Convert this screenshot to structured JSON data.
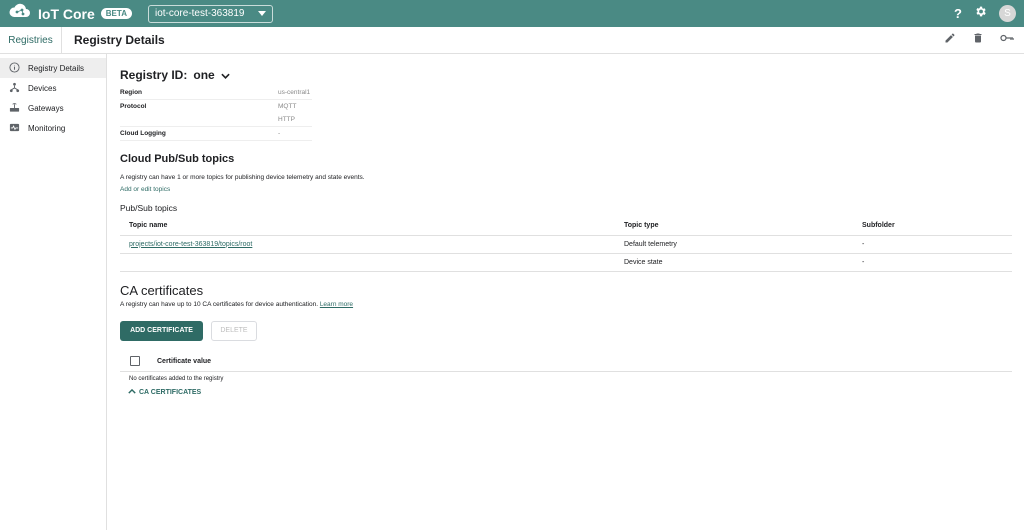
{
  "topbar": {
    "app_title": "IoT Core",
    "badge": "BETA",
    "project": "iot-core-test-363819",
    "avatar_initial": "S"
  },
  "subheader": {
    "breadcrumb_root": "Registries",
    "title": "Registry Details"
  },
  "sidebar": {
    "items": [
      {
        "label": "Registry Details",
        "icon": "info-icon"
      },
      {
        "label": "Devices",
        "icon": "devices-icon"
      },
      {
        "label": "Gateways",
        "icon": "router-icon"
      },
      {
        "label": "Monitoring",
        "icon": "monitoring-icon"
      }
    ]
  },
  "registry": {
    "id_label": "Registry ID:",
    "id_value": "one",
    "region_label": "Region",
    "region_value": "us-central1",
    "protocol_label": "Protocol",
    "protocol_values": [
      "MQTT",
      "HTTP"
    ],
    "logging_label": "Cloud Logging",
    "logging_value": "-"
  },
  "pubsub": {
    "title": "Cloud Pub/Sub topics",
    "description": "A registry can have 1 or more topics for publishing device telemetry and state events.",
    "edit_link": "Add or edit topics",
    "subtitle": "Pub/Sub topics",
    "columns": [
      "Topic name",
      "Topic type",
      "Subfolder"
    ],
    "rows": [
      {
        "name": "projects/iot-core-test-363819/topics/root",
        "type": "Default telemetry",
        "subfolder": "-"
      },
      {
        "name": "",
        "type": "Device state",
        "subfolder": "-"
      }
    ]
  },
  "ca": {
    "title": "CA certificates",
    "description": "A registry can have up to 10 CA certificates for device authentication.",
    "learn_more": "Learn more",
    "add_button": "ADD CERTIFICATE",
    "delete_button": "DELETE",
    "column": "Certificate value",
    "empty": "No certificates added to the registry",
    "toggle": "CA CERTIFICATES"
  },
  "colors": {
    "topbar": "#4a8a84",
    "accent": "#2e6b65"
  }
}
